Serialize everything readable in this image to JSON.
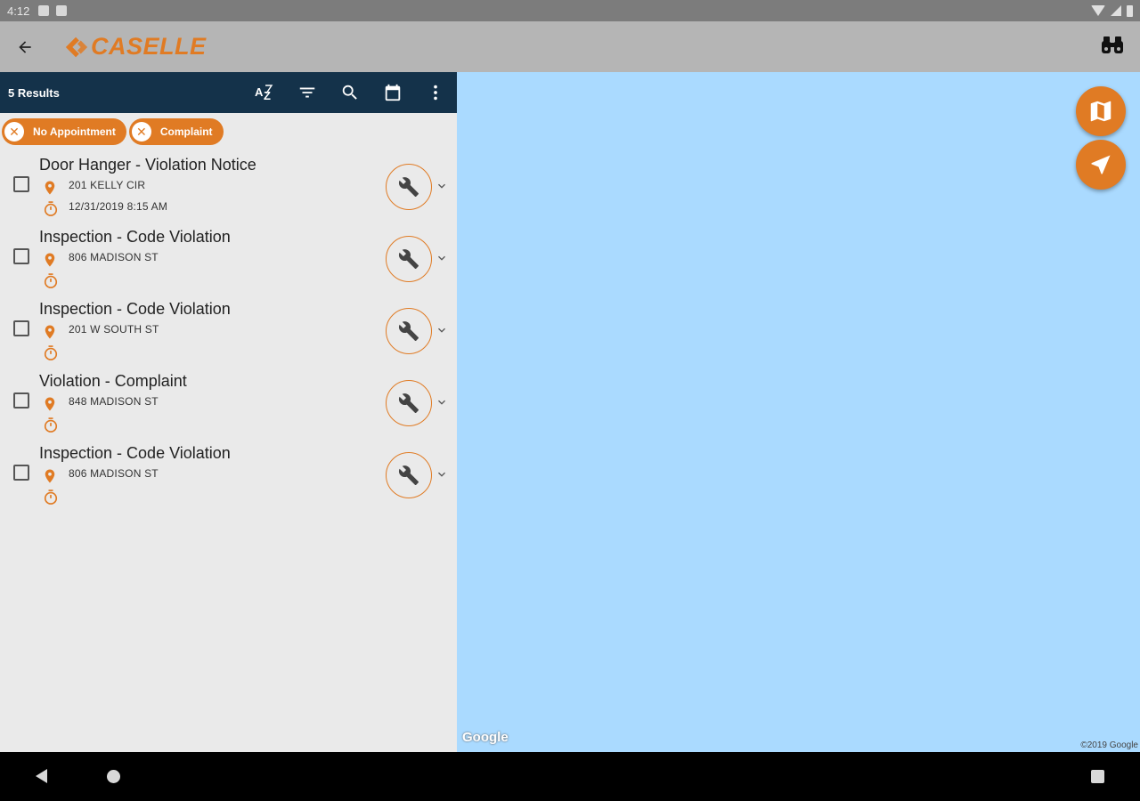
{
  "status_bar": {
    "time": "4:12"
  },
  "app_bar": {
    "logo_text": "CASELLE"
  },
  "toolbar": {
    "results_label": "5 Results"
  },
  "filter_chips": [
    {
      "label": "No Appointment"
    },
    {
      "label": "Complaint"
    }
  ],
  "items": [
    {
      "title": "Door Hanger - Violation Notice",
      "address": "201 KELLY CIR",
      "date": "12/31/2019 8:15 AM"
    },
    {
      "title": "Inspection - Code Violation",
      "address": "806 MADISON ST",
      "date": ""
    },
    {
      "title": "Inspection - Code Violation",
      "address": "201 W SOUTH ST",
      "date": ""
    },
    {
      "title": "Violation - Complaint",
      "address": "848 MADISON ST",
      "date": ""
    },
    {
      "title": "Inspection - Code Violation",
      "address": "806 MADISON ST",
      "date": ""
    }
  ],
  "map": {
    "google_label": "Google",
    "copyright": "©2019 Google"
  },
  "colors": {
    "accent": "#e07b24",
    "toolbar_bg": "#14324a",
    "map_water": "#aadaff",
    "app_bar_bg": "#b5b5b5"
  }
}
